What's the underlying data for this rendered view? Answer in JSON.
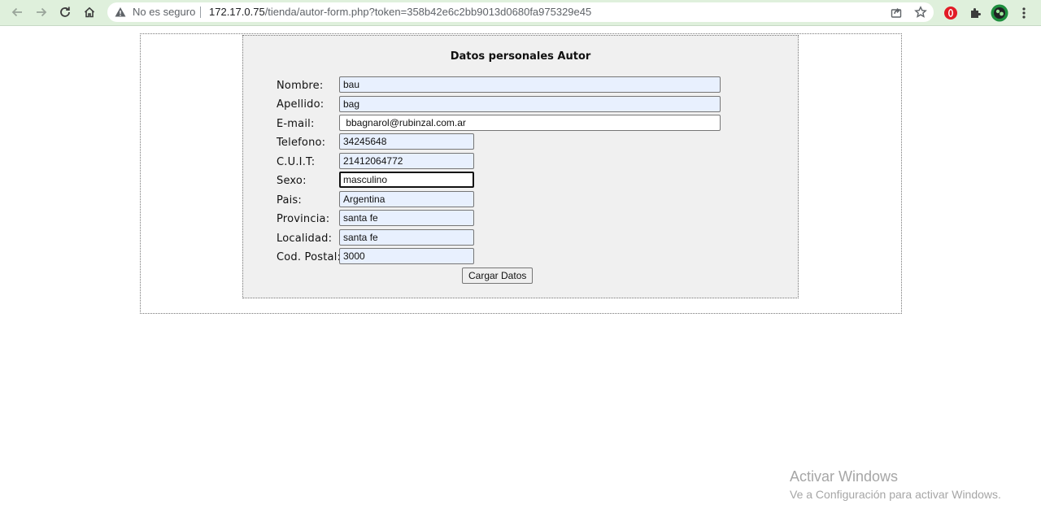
{
  "browser": {
    "security_text": "No es seguro",
    "url_host": "172.17.0.75",
    "url_path": "/tienda/autor-form.php?token=358b42e6c2bb9013d0680fa975329e45",
    "icons": [
      "back-icon",
      "forward-icon",
      "reload-icon",
      "home-icon",
      "warning-icon",
      "share-icon",
      "star-icon",
      "opera-extension-icon",
      "puzzle-icon",
      "avatar"
    ]
  },
  "form": {
    "title": "Datos personales Autor",
    "fields": [
      {
        "label": "Nombre:",
        "value": "bau"
      },
      {
        "label": "Apellido:",
        "value": "bag"
      },
      {
        "label": "E-mail:",
        "value": " bbagnarol@rubinzal.com.ar"
      },
      {
        "label": "Telefono:",
        "value": "34245648"
      },
      {
        "label": "C.U.I.T:",
        "value": "21412064772"
      },
      {
        "label": "Sexo:",
        "value": "masculino"
      },
      {
        "label": "Pais:",
        "value": "Argentina"
      },
      {
        "label": "Provincia:",
        "value": "santa fe"
      },
      {
        "label": "Localidad:",
        "value": "santa fe"
      },
      {
        "label": "Cod. Postal:",
        "value": "3000"
      }
    ],
    "submit_label": "Cargar Datos"
  },
  "watermark": {
    "title": "Activar Windows",
    "subtitle": "Ve a Configuración para activar Windows."
  },
  "colors": {
    "chrome_bg": "#dff0dc",
    "autofill_bg": "#e8f0fe",
    "panel_bg": "#f0f0f0"
  }
}
